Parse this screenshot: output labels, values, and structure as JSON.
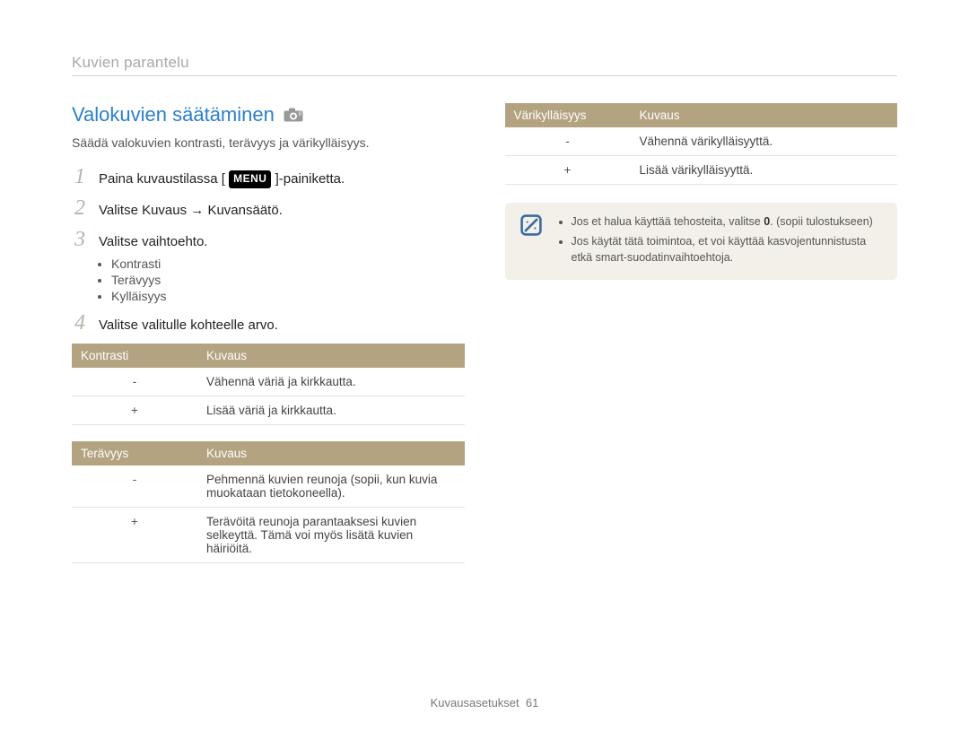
{
  "breadcrumb": "Kuvien parantelu",
  "heading": "Valokuvien säätäminen",
  "intro": "Säädä valokuvien kontrasti, terävyys ja värikylläisyys.",
  "steps": {
    "s1a": "Paina kuvaustilassa [",
    "s1_menu": "MENU",
    "s1b": "]-painiketta.",
    "s2": "Valitse Kuvaus → Kuvansäätö.",
    "s3": "Valitse vaitoehto.",
    "s3_fixed": "Valitse vaihtoehto.",
    "s4": "Valitse valitulle kohteelle arvo."
  },
  "bullets": {
    "b1": "Kontrasti",
    "b2": "Terävyys",
    "b3": "Kylläisyys"
  },
  "t1": {
    "h1": "Kontrasti",
    "h2": "Kuvaus",
    "r1": "Vähennä väriä ja kirkkautta.",
    "r2": "Lisää väriä ja kirkkautta."
  },
  "t2": {
    "h1": "Terävyys",
    "h2": "Kuvaus",
    "r1": "Pehmennä kuvien reunoja (sopii, kun kuvia muokataan tietokoneella).",
    "r2": "Terävöitä reunoja parantaaksesi kuvien selkeyttä. Tämä voi myös lisätä kuvien häiriöitä."
  },
  "t3": {
    "h1": "Värikylläisyys",
    "h2": "Kuvaus",
    "r1": "Vähennä värikylläisyyttä.",
    "r2": "Lisää värikylläisyyttä."
  },
  "sym": {
    "minus": "-",
    "plus": "+"
  },
  "note": {
    "n1a": "Jos et halua käyttää tehosteita, valitse ",
    "n1_zero": "0",
    "n1b": ". (sopii tulostukseen)",
    "n2": "Jos käytät tätä toimintoa, et voi käyttää kasvojentunnistusta etkä smart-suodatinvaihtoehtoja."
  },
  "footer": {
    "label": "Kuvausasetukset",
    "page": "61"
  }
}
